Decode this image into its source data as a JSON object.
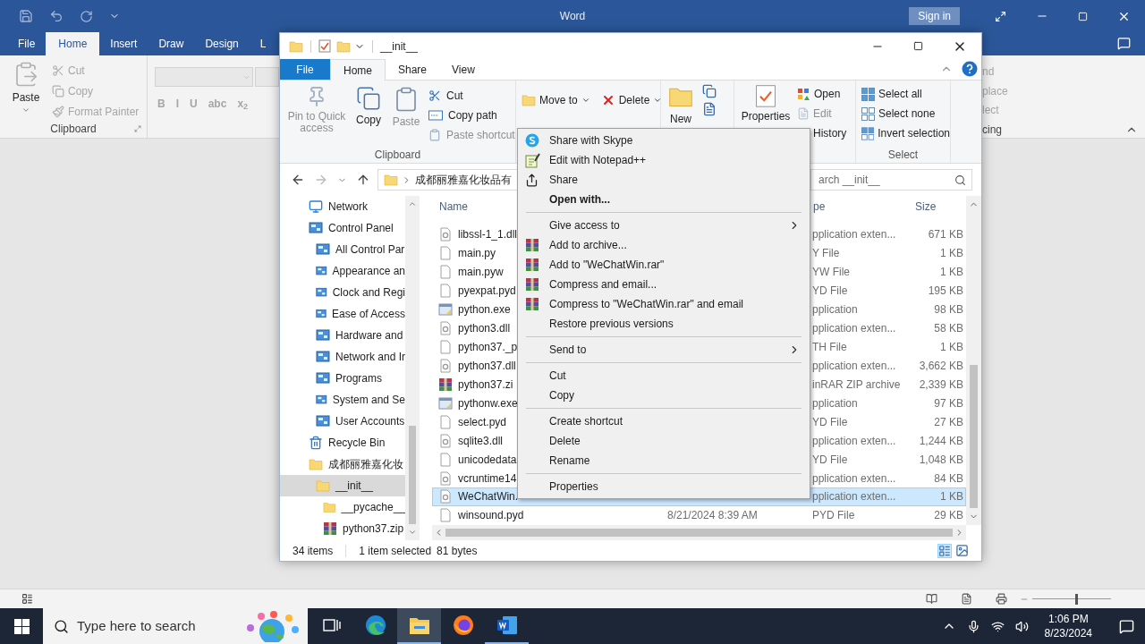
{
  "word": {
    "title": "Word",
    "sign_in": "Sign in",
    "tabs": [
      {
        "label": "File",
        "selected": false
      },
      {
        "label": "Home",
        "selected": true
      },
      {
        "label": "Insert",
        "selected": false
      },
      {
        "label": "Draw",
        "selected": false
      },
      {
        "label": "Design",
        "selected": false
      },
      {
        "label": "L",
        "selected": false
      }
    ],
    "ribbon_disabled": true,
    "clipboard": {
      "paste": "Paste",
      "cut": "Cut",
      "copy": "Copy",
      "format_painter": "Format Painter",
      "label": "Clipboard"
    },
    "format_buttons": [
      "B",
      "I",
      "U",
      "abc",
      "x$_{2}$"
    ],
    "editing_fragments": [
      "nd",
      "place",
      "lect"
    ],
    "editing_label": "cing",
    "zoom": {
      "level": 0.55
    }
  },
  "explorer": {
    "title": "__init__",
    "tabs": [
      {
        "label": "File",
        "kind": "file",
        "selected": false
      },
      {
        "label": "Home",
        "kind": "tab",
        "selected": true
      },
      {
        "label": "Share",
        "kind": "tab",
        "selected": false
      },
      {
        "label": "View",
        "kind": "tab",
        "selected": false
      }
    ],
    "clipboard": {
      "label": "Clipboard",
      "large": [
        {
          "label": "Pin to Quick access",
          "kind": "pin",
          "disabled": true
        },
        {
          "label": "Copy",
          "kind": "copy",
          "disabled": false
        },
        {
          "label": "Paste",
          "kind": "paste",
          "disabled": true
        }
      ],
      "small": [
        {
          "label": "Cut",
          "kind": "cut",
          "disabled": false
        },
        {
          "label": "Copy path",
          "kind": "path",
          "disabled": false
        },
        {
          "label": "Paste shortcut",
          "kind": "shortcut",
          "disabled": true
        }
      ]
    },
    "organize": [
      {
        "label": "Move to",
        "kind": "move"
      },
      {
        "label": "Delete",
        "kind": "delete"
      }
    ],
    "new": {
      "label": "New"
    },
    "open": {
      "properties": "Properties",
      "items": [
        {
          "label": "Open",
          "kind": "open",
          "disabled": false
        },
        {
          "label": "Edit",
          "kind": "edit",
          "disabled": true
        },
        {
          "label": "History",
          "kind": "history",
          "disabled": false
        }
      ]
    },
    "select": {
      "label": "Select",
      "items": [
        "Select all",
        "Select none",
        "Invert selection"
      ]
    },
    "address": "成都丽雅嘉化妆品有",
    "search_placeholder": "arch __init__",
    "nav": [
      {
        "label": "Network",
        "kind": "network",
        "selected": false
      },
      {
        "label": "Control Panel",
        "kind": "panel",
        "selected": false,
        "children": [
          {
            "label": "All Control Par",
            "kind": "panel",
            "selected": false
          },
          {
            "label": "Appearance an",
            "kind": "panel",
            "selected": false
          },
          {
            "label": "Clock and Regi",
            "kind": "panel",
            "selected": false
          },
          {
            "label": "Ease of Access",
            "kind": "panel",
            "selected": false
          },
          {
            "label": "Hardware and",
            "kind": "panel",
            "selected": false
          },
          {
            "label": "Network and Ir",
            "kind": "panel",
            "selected": false
          },
          {
            "label": "Programs",
            "kind": "panel",
            "selected": false
          },
          {
            "label": "System and Se",
            "kind": "panel",
            "selected": false
          },
          {
            "label": "User Accounts",
            "kind": "panel",
            "selected": false
          }
        ]
      },
      {
        "label": "Recycle Bin",
        "kind": "bin",
        "selected": false
      },
      {
        "label": "成都丽雅嘉化妆",
        "kind": "folder",
        "selected": false,
        "children": [
          {
            "label": "__init__",
            "kind": "folder",
            "selected": true,
            "children": [
              {
                "label": "__pycache__",
                "kind": "folder",
                "selected": false
              },
              {
                "label": "python37.zip",
                "kind": "zip",
                "selected": false
              }
            ]
          }
        ]
      }
    ],
    "columns": [
      "Name",
      "pe",
      "Size"
    ],
    "files": [
      {
        "name": "libssl-1_1.dll",
        "kind": "dll",
        "type": "pplication exten...",
        "size": "671 KB",
        "selected": false
      },
      {
        "name": "main.py",
        "kind": "file",
        "type": "Y File",
        "size": "1 KB",
        "selected": false
      },
      {
        "name": "main.pyw",
        "kind": "file",
        "type": "YW File",
        "size": "1 KB",
        "selected": false
      },
      {
        "name": "pyexpat.pyd",
        "kind": "file",
        "type": "YD File",
        "size": "195 KB",
        "selected": false
      },
      {
        "name": "python.exe",
        "kind": "exe",
        "type": "pplication",
        "size": "98 KB",
        "selected": false
      },
      {
        "name": "python3.dll",
        "kind": "dll",
        "type": "pplication exten...",
        "size": "58 KB",
        "selected": false
      },
      {
        "name": "python37._p",
        "kind": "file",
        "type": "TH File",
        "size": "1 KB",
        "selected": false
      },
      {
        "name": "python37.dll",
        "kind": "dll",
        "type": "pplication exten...",
        "size": "3,662 KB",
        "selected": false
      },
      {
        "name": "python37.zi",
        "kind": "zip",
        "type": "inRAR ZIP archive",
        "size": "2,339 KB",
        "selected": false
      },
      {
        "name": "pythonw.exe",
        "kind": "exe",
        "type": "pplication",
        "size": "97 KB",
        "selected": false
      },
      {
        "name": "select.pyd",
        "kind": "file",
        "type": "YD File",
        "size": "27 KB",
        "selected": false
      },
      {
        "name": "sqlite3.dll",
        "kind": "dll",
        "type": "pplication exten...",
        "size": "1,244 KB",
        "selected": false
      },
      {
        "name": "unicodedata",
        "kind": "file",
        "type": "YD File",
        "size": "1,048 KB",
        "selected": false
      },
      {
        "name": "vcruntime14",
        "kind": "dll",
        "type": "pplication exten...",
        "size": "84 KB",
        "selected": false
      },
      {
        "name": "WeChatWin.",
        "kind": "dll",
        "type": "pplication exten...",
        "size": "1 KB",
        "selected": true
      },
      {
        "name": "winsound.pyd",
        "kind": "file",
        "date": "8/21/2024 8:39 AM",
        "type": "PYD File",
        "size": "29 KB",
        "selected": false
      }
    ],
    "status": {
      "count": "34 items",
      "selection": "1 item selected",
      "size": "81 bytes"
    }
  },
  "context_menu": [
    [
      {
        "label": "Share with Skype",
        "kind": "skype"
      },
      {
        "label": "Edit with Notepad++",
        "kind": "notepad"
      },
      {
        "label": "Share",
        "kind": "share"
      },
      {
        "label": "Open with...",
        "kind": "default"
      }
    ],
    [
      {
        "label": "Give access to",
        "kind": "submenu"
      },
      {
        "label": "Add to archive...",
        "kind": "archive"
      },
      {
        "label": "Add to \"WeChatWin.rar\"",
        "kind": "archive"
      },
      {
        "label": "Compress and email...",
        "kind": "archive"
      },
      {
        "label": "Compress to \"WeChatWin.rar\" and email",
        "kind": "archive"
      },
      {
        "label": "Restore previous versions",
        "kind": "plain"
      }
    ],
    [
      {
        "label": "Send to",
        "kind": "submenu"
      }
    ],
    [
      {
        "label": "Cut",
        "kind": "plain"
      },
      {
        "label": "Copy",
        "kind": "plain"
      }
    ],
    [
      {
        "label": "Create shortcut",
        "kind": "plain"
      },
      {
        "label": "Delete",
        "kind": "plain"
      },
      {
        "label": "Rename",
        "kind": "plain"
      }
    ],
    [
      {
        "label": "Properties",
        "kind": "plain"
      }
    ]
  ],
  "taskbar": {
    "search_placeholder": "Type here to search",
    "apps": [
      {
        "kind": "taskview",
        "selected": false,
        "running": false
      },
      {
        "kind": "edge",
        "selected": false,
        "running": false
      },
      {
        "kind": "explorer",
        "selected": true,
        "running": true
      },
      {
        "kind": "firefox",
        "selected": false,
        "running": false
      },
      {
        "kind": "word",
        "selected": false,
        "running": true
      }
    ],
    "time": "1:06 PM",
    "date": "8/23/2024"
  }
}
